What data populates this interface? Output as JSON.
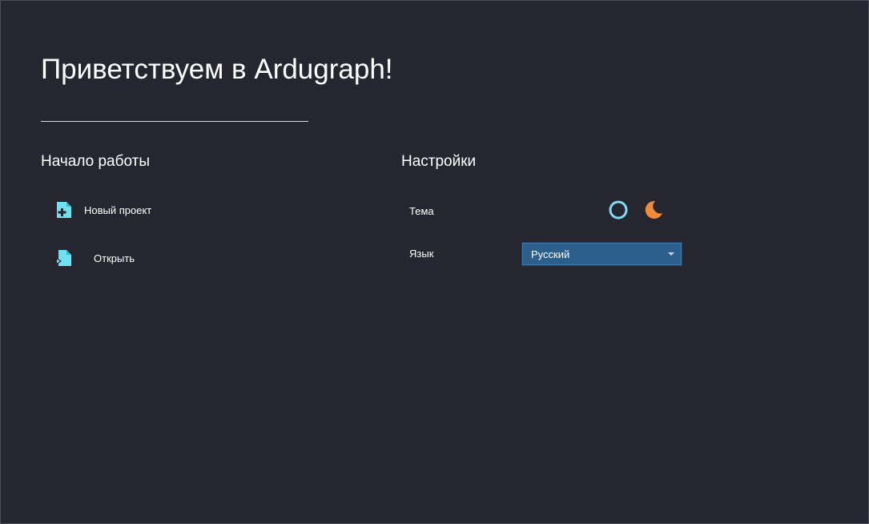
{
  "welcome": {
    "title": "Приветствуем в Ardugraph!"
  },
  "start": {
    "heading": "Начало работы",
    "new_project": {
      "label": "Новый проект",
      "icon": "new-file-icon"
    },
    "open": {
      "label": "Открыть",
      "icon": "open-file-icon"
    }
  },
  "settings": {
    "heading": "Настройки",
    "theme": {
      "label": "Тема",
      "options": [
        {
          "icon": "light-theme-icon",
          "color": "#7fdcf3"
        },
        {
          "icon": "dark-theme-icon",
          "color": "#f08a3c"
        }
      ]
    },
    "language": {
      "label": "Язык",
      "selected": "Русский"
    }
  },
  "colors": {
    "background": "#252630",
    "accent_icon": "#6fe0f0",
    "select_bg": "#2d5f8c"
  }
}
